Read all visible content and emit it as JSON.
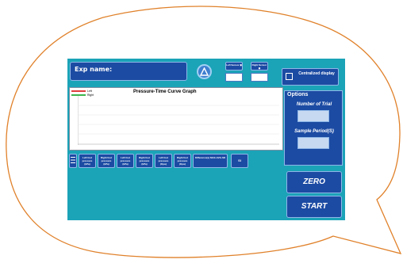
{
  "experiment": {
    "name_label": "Exp name:"
  },
  "header": {
    "left_sensor": "Left Sensor ◼",
    "right_sensor": "Right Sensor ◼",
    "centralized_display": "Centralized display"
  },
  "graph": {
    "title": "Pressure-Time Curve Graph",
    "legend": [
      {
        "label": "Left",
        "color": "#e03c3c"
      },
      {
        "label": "Right",
        "color": "#3cb44b"
      }
    ]
  },
  "stats": [
    {
      "label": "Left foot pressure (kPa)"
    },
    {
      "label": "Right foot pressure (kPa)"
    },
    {
      "label": "Left foot pressure (kPa)"
    },
    {
      "label": "Right foot pressure (kPa)"
    },
    {
      "label": "Left foot pressure (Kpa)"
    },
    {
      "label": "Right foot pressure (Kpa)"
    },
    {
      "label": "Difference(s) MAX-AVG-SD"
    },
    {
      "label": "SI"
    }
  ],
  "options": {
    "title": "Options",
    "number_of_trial": "Number of Trial",
    "sample_period": "Sample Period(S)"
  },
  "buttons": {
    "zero": "ZERO",
    "start": "START"
  },
  "colors": {
    "panel": "#1ba3b8",
    "button": "#1c4ba3",
    "bubble_border": "#e0812a"
  }
}
